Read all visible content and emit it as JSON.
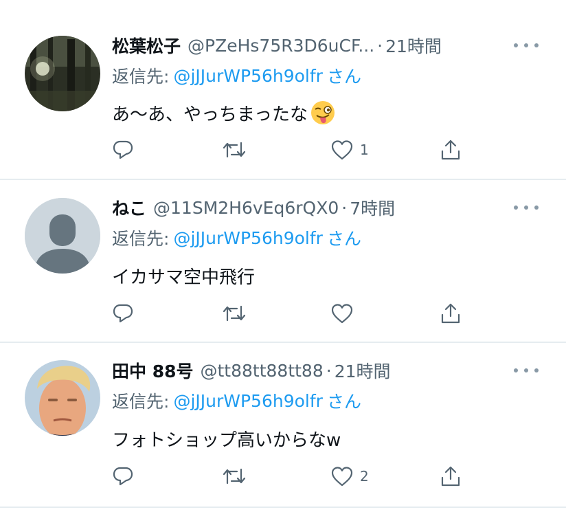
{
  "tweets": [
    {
      "name": "松葉松子",
      "handle": "@PZeHs75R3D6uCF...",
      "dot": "·",
      "time": "21時間",
      "reply_prefix": "返信先:",
      "reply_to": "@jJJurWP56h9olfr",
      "reply_suffix": "さん",
      "text": "あ〜あ、やっちまったな",
      "emoji": "winking-face-with-tongue",
      "like_count": "1"
    },
    {
      "name": "ねこ",
      "handle": "@11SM2H6vEq6rQX0",
      "dot": "·",
      "time": "7時間",
      "reply_prefix": "返信先:",
      "reply_to": "@jJJurWP56h9olfr",
      "reply_suffix": "さん",
      "text": "イカサマ空中飛行",
      "like_count": ""
    },
    {
      "name": "田中 88号",
      "handle": "@tt88tt88tt88",
      "dot": "·",
      "time": "21時間",
      "reply_prefix": "返信先:",
      "reply_to": "@jJJurWP56h9olfr",
      "reply_suffix": "さん",
      "text": "フォトショップ高いからなw",
      "like_count": "2"
    }
  ],
  "icons": [
    "reply-icon",
    "retweet-icon",
    "like-icon",
    "share-icon",
    "more-icon"
  ],
  "colors": {
    "link": "#1d9bf0",
    "secondary_text": "#536471",
    "icon": "#536471",
    "divider": "#e6ecf0"
  }
}
